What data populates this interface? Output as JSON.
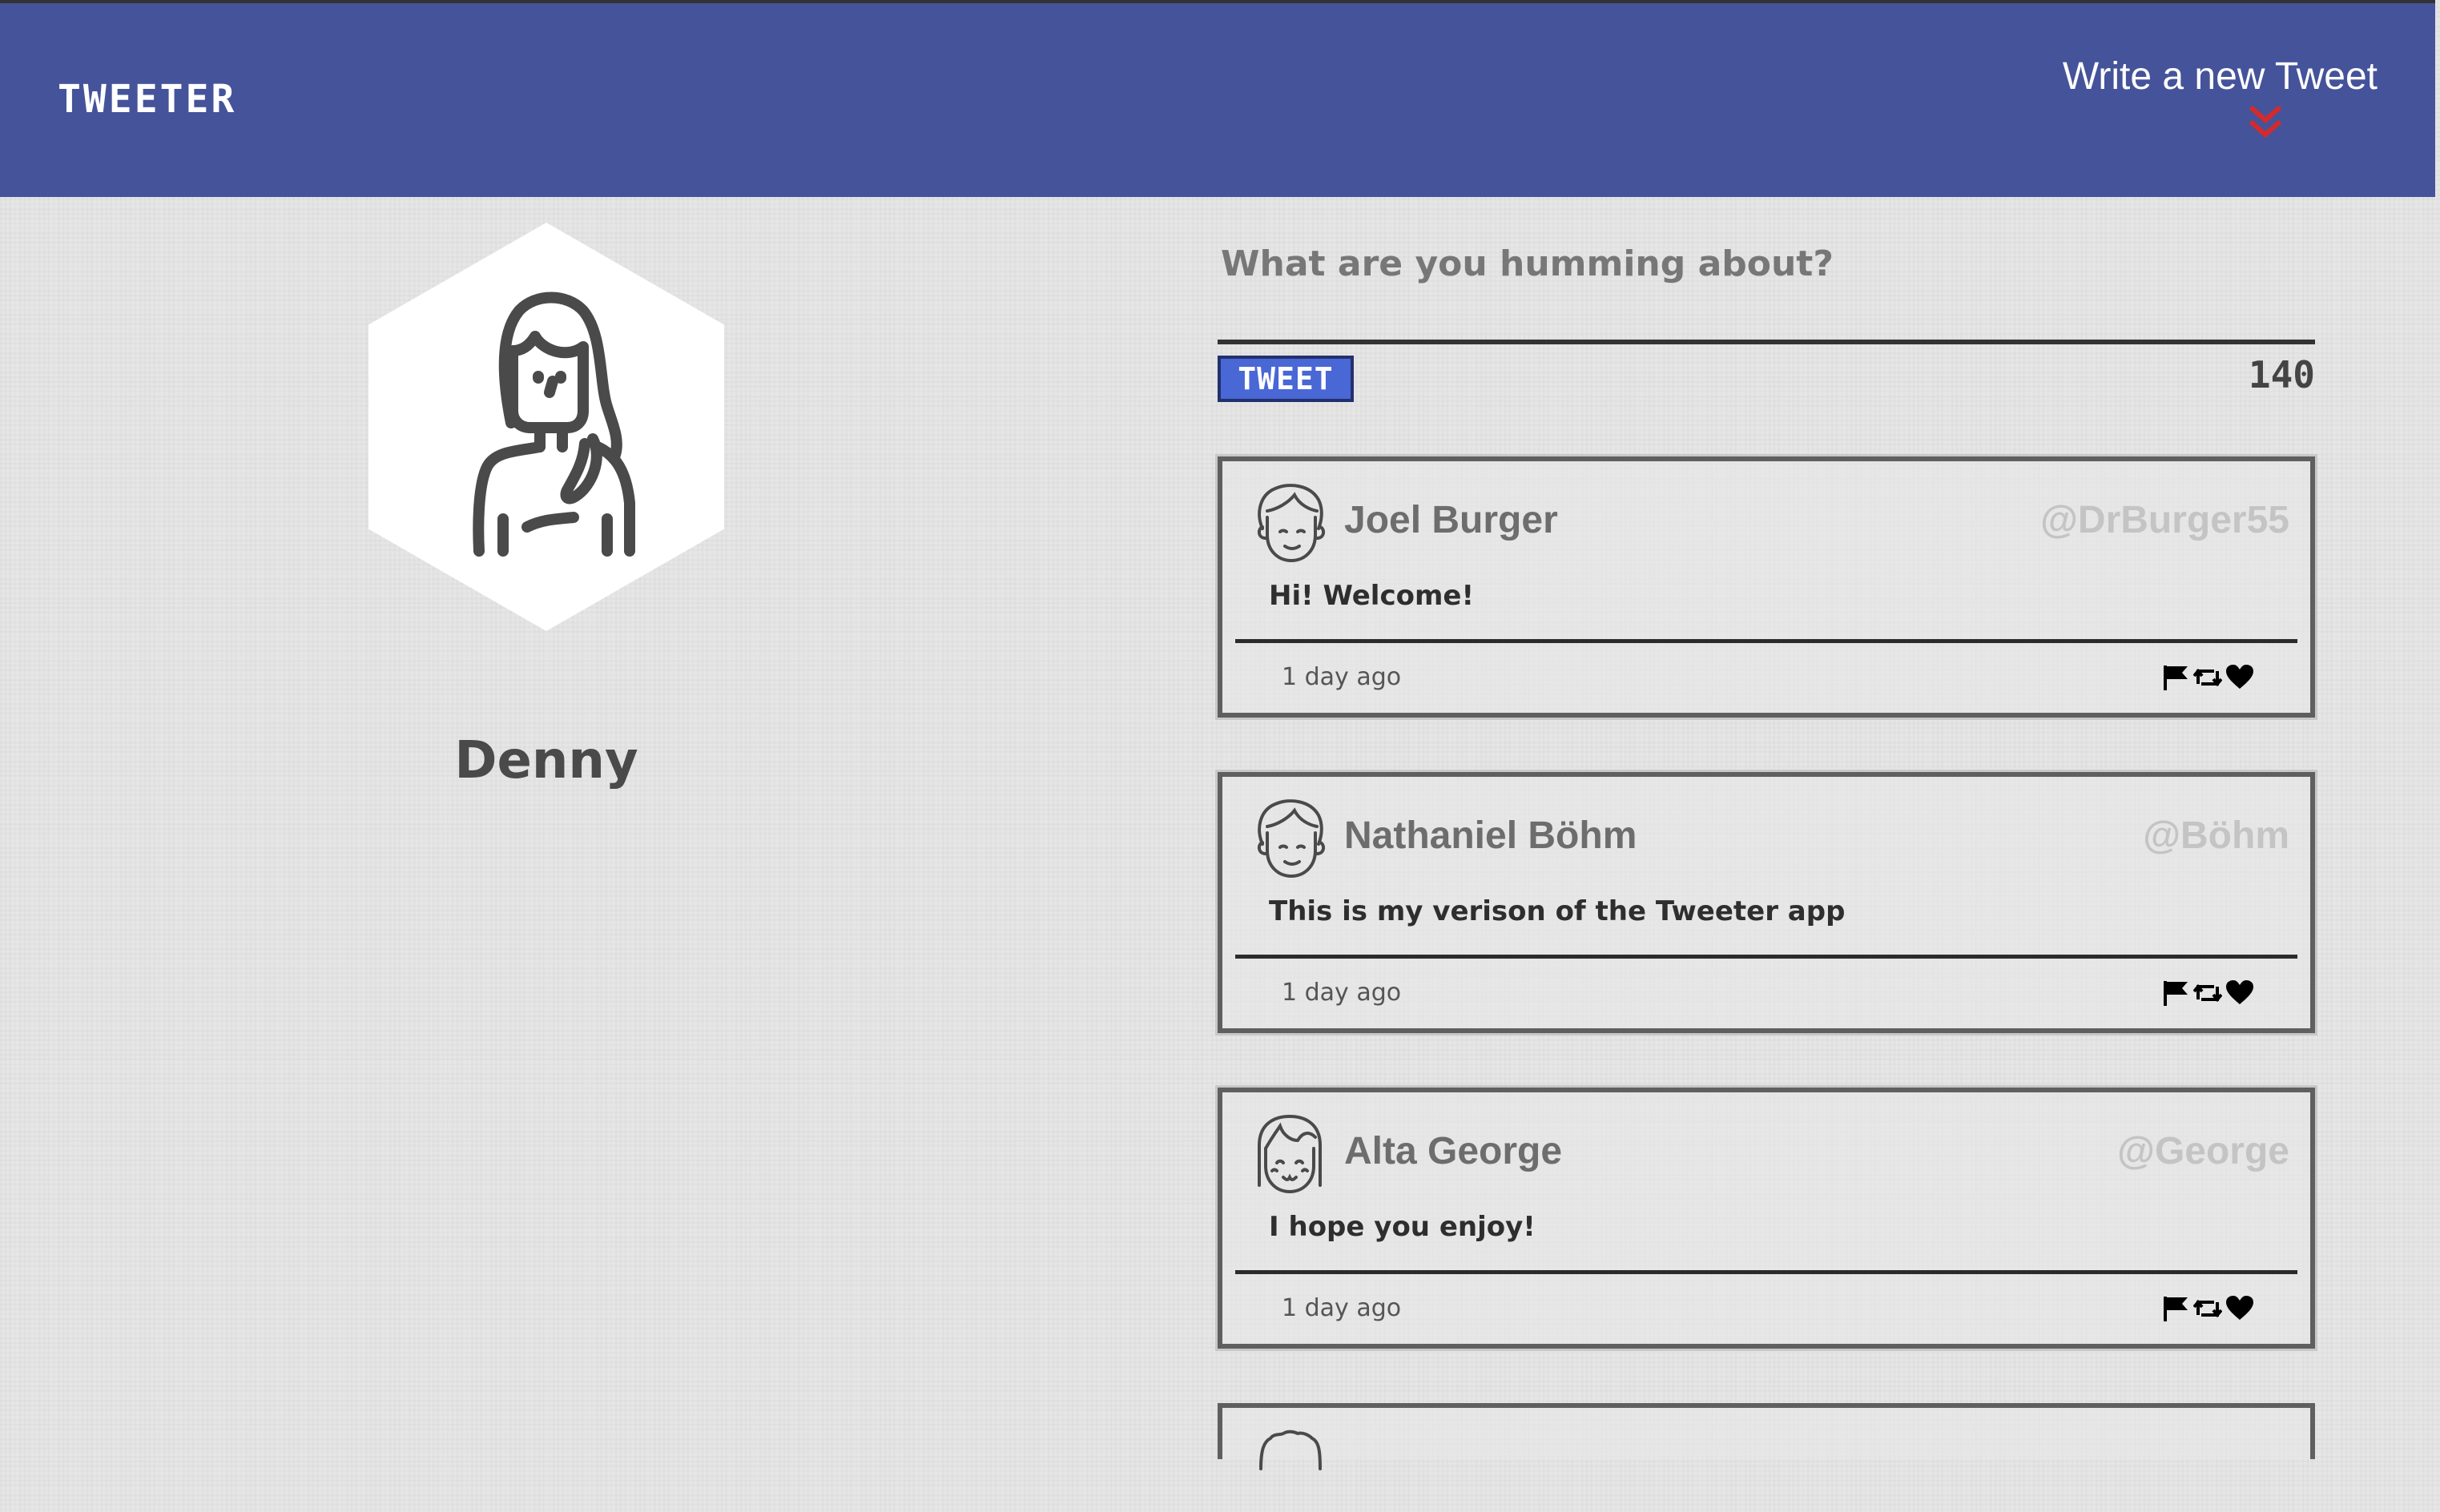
{
  "nav": {
    "brand": "TWEETER",
    "compose_label": "Write a new Tweet",
    "compose_icon": "double-chevron-down-icon",
    "bg_color": "#45539a",
    "accent_color": "#d62a2a"
  },
  "profile": {
    "name": "Denny",
    "avatar_icon": "woman-avatar-icon"
  },
  "composer": {
    "placeholder": "What are you humming about?",
    "value": "",
    "submit_label": "TWEET",
    "counter": "140",
    "button_color": "#4a67d6"
  },
  "tweets": [
    {
      "name": "Joel Burger",
      "handle": "@DrBurger55",
      "text": "Hi! Welcome!",
      "time": "1 day ago",
      "avatar_icon": "man-avatar-icon"
    },
    {
      "name": "Nathaniel Böhm",
      "handle": "@Böhm",
      "text": "This is my verison of the Tweeter app",
      "time": "1 day ago",
      "avatar_icon": "man-avatar-icon"
    },
    {
      "name": "Alta George",
      "handle": "@George",
      "text": "I hope you enjoy!",
      "time": "1 day ago",
      "avatar_icon": "woman-bangs-avatar-icon"
    }
  ],
  "tweet_actions": [
    "flag-icon",
    "retweet-icon",
    "heart-icon"
  ]
}
